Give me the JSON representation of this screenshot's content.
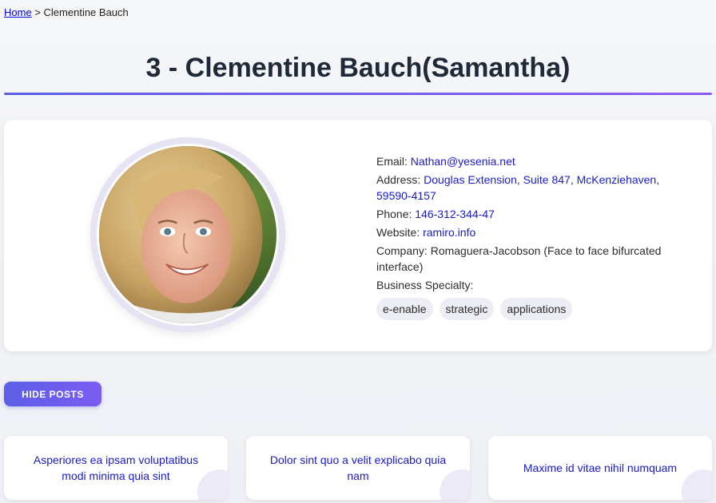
{
  "breadcrumb": {
    "home": "Home",
    "separator": ">",
    "current": "Clementine Bauch"
  },
  "page": {
    "title": "3 - Clementine Bauch(Samantha)"
  },
  "profile": {
    "email_label": "Email:",
    "email": "Nathan@yesenia.net",
    "address_label": "Address:",
    "address": "Douglas Extension, Suite 847, McKenziehaven, 59590-4157",
    "phone_label": "Phone:",
    "phone": "146-312-344-47",
    "website_label": "Website:",
    "website": "ramiro.info",
    "company_label": "Company:",
    "company": "Romaguera-Jacobson (Face to face bifurcated interface)",
    "specialty_label": "Business Specialty:",
    "tags": [
      "e-enable",
      "strategic",
      "applications"
    ]
  },
  "actions": {
    "hide_posts": "HIDE POSTS"
  },
  "posts": [
    {
      "title": "Asperiores ea ipsam voluptatibus modi minima quia sint"
    },
    {
      "title": "Dolor sint quo a velit explicabo quia nam"
    },
    {
      "title": "Maxime id vitae nihil numquam"
    }
  ],
  "colors": {
    "accent_start": "#5b5fe0",
    "accent_end": "#8b5cf6",
    "link": "#1a1acc"
  }
}
